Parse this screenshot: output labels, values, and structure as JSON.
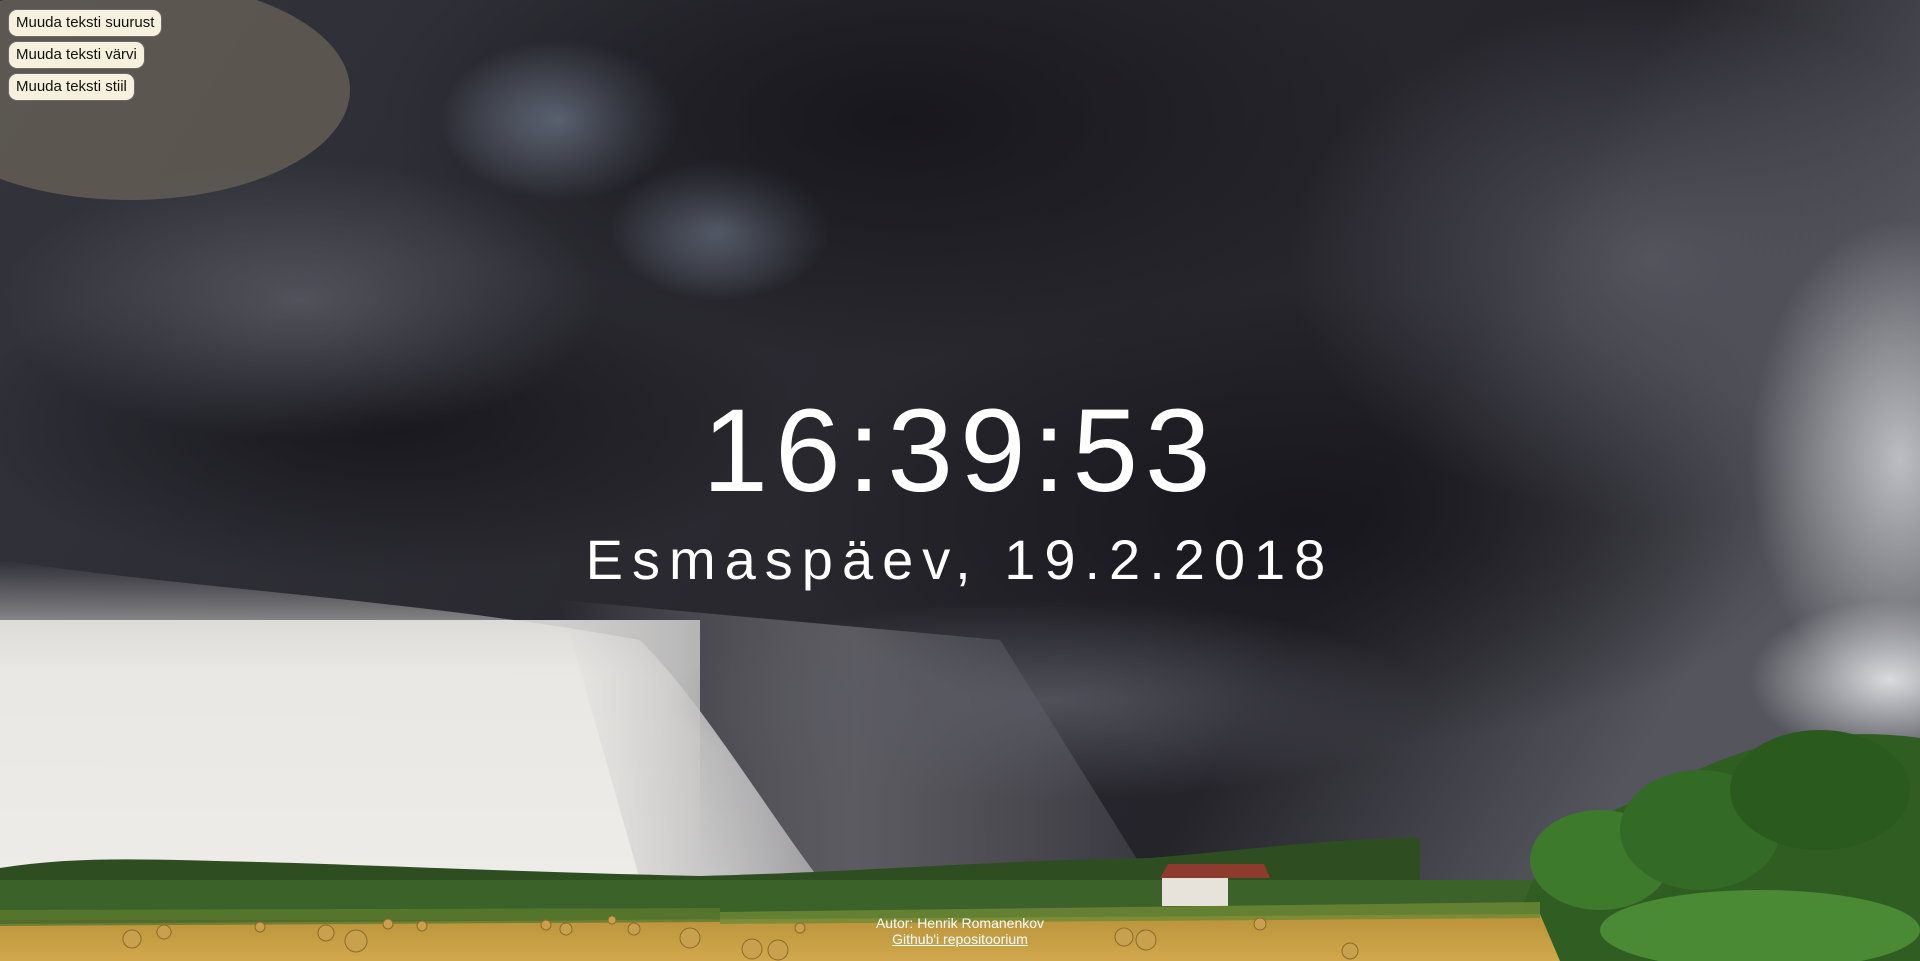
{
  "controls": {
    "size_button": "Muuda teksti suurust",
    "color_button": "Muuda teksti värvi",
    "style_button": "Muuda teksti stiil"
  },
  "clock": {
    "time": "16:39:53",
    "date": "Esmaspäev, 19.2.2018"
  },
  "footer": {
    "author": "Autor: Henrik Romanenkov",
    "repo_link": "Github'i repositoorium"
  },
  "background": {
    "scene": "storm-clouds-over-field",
    "colors": {
      "cloud_dark": "#1d1c24",
      "cloud_mid": "#4a4a55",
      "sky_light": "#e9e8e6",
      "trees": "#2f5d22",
      "field": "#c79a3a"
    }
  }
}
